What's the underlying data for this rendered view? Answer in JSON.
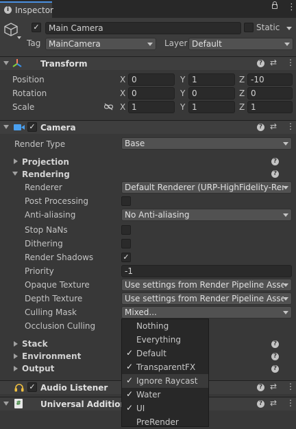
{
  "tab": {
    "title": "Inspector"
  },
  "gameobject": {
    "name": "Main Camera",
    "static_label": "Static",
    "tag_label": "Tag",
    "tag_value": "MainCamera",
    "layer_label": "Layer",
    "layer_value": "Default"
  },
  "transform": {
    "title": "Transform",
    "rows": [
      {
        "label": "Position",
        "x": "0",
        "y": "1",
        "z": "-10"
      },
      {
        "label": "Rotation",
        "x": "0",
        "y": "0",
        "z": "0"
      },
      {
        "label": "Scale",
        "x": "1",
        "y": "1",
        "z": "1"
      }
    ],
    "axis": {
      "x": "X",
      "y": "Y",
      "z": "Z"
    }
  },
  "camera": {
    "title": "Camera",
    "render_type_label": "Render Type",
    "render_type_value": "Base",
    "projection": "Projection",
    "rendering": "Rendering",
    "rows": {
      "renderer": {
        "label": "Renderer",
        "value": "Default Renderer (URP-HighFidelity-Ren"
      },
      "post_processing": {
        "label": "Post Processing"
      },
      "anti_aliasing": {
        "label": "Anti-aliasing",
        "value": "No Anti-aliasing"
      },
      "stop_nans": {
        "label": "Stop NaNs"
      },
      "dithering": {
        "label": "Dithering"
      },
      "render_shadows": {
        "label": "Render Shadows",
        "check": "✓"
      },
      "priority": {
        "label": "Priority",
        "value": "-1"
      },
      "opaque_texture": {
        "label": "Opaque Texture",
        "value": "Use settings from Render Pipeline Asset"
      },
      "depth_texture": {
        "label": "Depth Texture",
        "value": "Use settings from Render Pipeline Asset"
      },
      "culling_mask": {
        "label": "Culling Mask",
        "value": "Mixed..."
      },
      "occlusion_culling": {
        "label": "Occlusion Culling"
      }
    },
    "stack": "Stack",
    "environment": "Environment",
    "output": "Output"
  },
  "audio_listener": {
    "title": "Audio Listener"
  },
  "universal_additional": {
    "title": "Universal Additional"
  },
  "culling_menu": {
    "items": [
      {
        "label": "Nothing",
        "check": ""
      },
      {
        "label": "Everything",
        "check": ""
      },
      {
        "label": "Default",
        "check": "✓"
      },
      {
        "label": "TransparentFX",
        "check": "✓"
      },
      {
        "label": "Ignore Raycast",
        "check": "✓"
      },
      {
        "label": "Water",
        "check": "✓"
      },
      {
        "label": "UI",
        "check": "✓"
      },
      {
        "label": "PreRender",
        "check": ""
      }
    ]
  },
  "glyphs": {
    "help": "?",
    "settings": "⇄",
    "more": "⋮",
    "lock": "🔒",
    "check": "✓"
  },
  "colors": {
    "background": "#383838",
    "header": "#3e3e3e",
    "field": "#2a2a2a",
    "dropdown": "#515151",
    "accent_blue": "#4a90e2",
    "menu": "#282828"
  }
}
